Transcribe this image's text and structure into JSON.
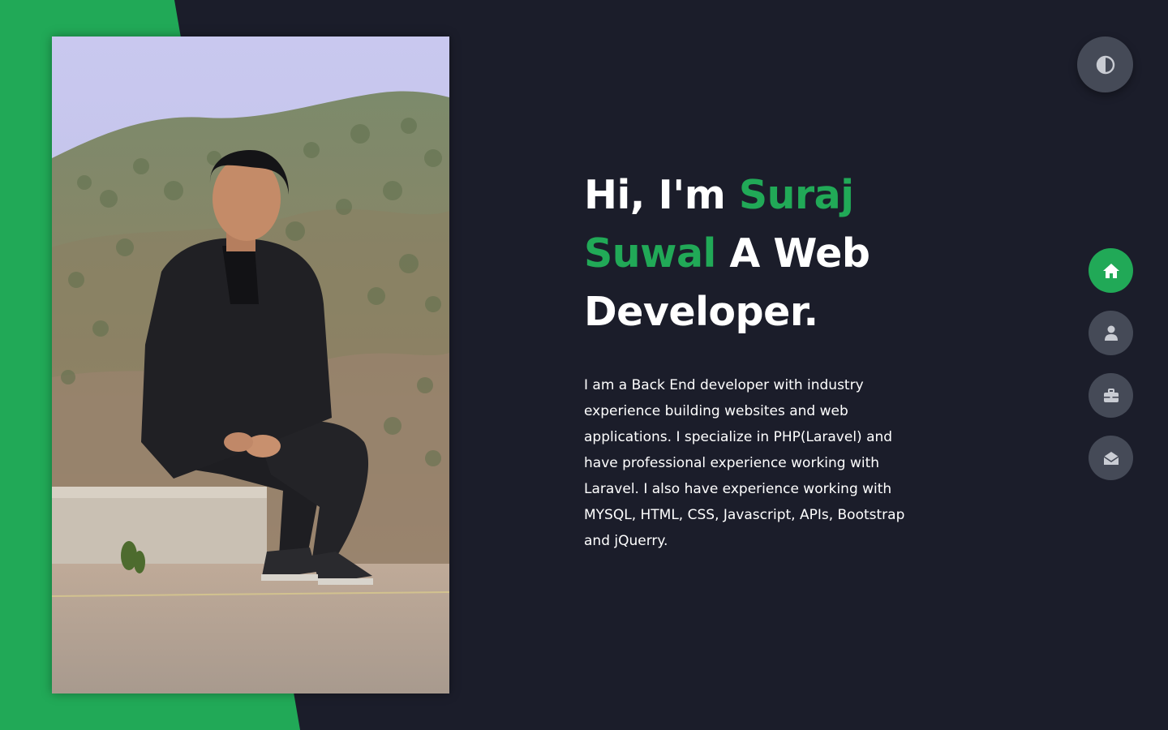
{
  "hero": {
    "greeting": "Hi, I'm ",
    "name_part1": "Suraj",
    "name_part2": "Suwal",
    "role": " A Web",
    "role_line2": "Developer.",
    "description": "I am a Back End developer with industry experience building websites and web applications. I specialize in PHP(Laravel) and have professional experience working with Laravel. I also have experience working with MYSQL, HTML, CSS, Javascript, APIs, Bootstrap and jQuerry."
  },
  "theme_toggle": {
    "icon": "contrast-icon"
  },
  "nav": {
    "items": [
      {
        "icon": "home-icon",
        "active": true
      },
      {
        "icon": "user-icon",
        "active": false
      },
      {
        "icon": "briefcase-icon",
        "active": false
      },
      {
        "icon": "envelope-open-icon",
        "active": false
      }
    ]
  },
  "colors": {
    "background": "#1b1d2a",
    "accent": "#21a957",
    "button": "#454a57",
    "text": "#ffffff"
  }
}
